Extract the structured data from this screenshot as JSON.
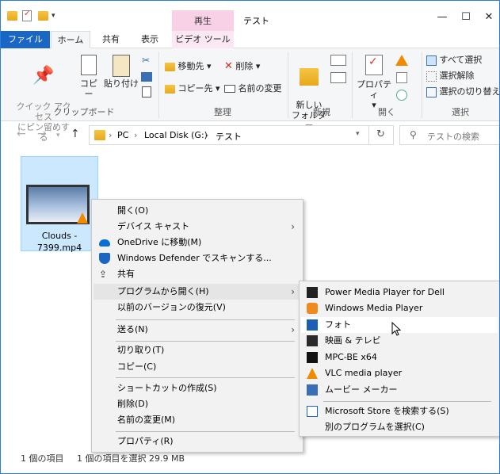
{
  "title_bar": {
    "context_tab": "再生",
    "window_title": "テスト",
    "minimize": "—",
    "maximize": "☐",
    "close": "✕"
  },
  "tabs": [
    {
      "label": "ファイル"
    },
    {
      "label": "ホーム"
    },
    {
      "label": "共有"
    },
    {
      "label": "表示"
    },
    {
      "label": "ビデオ ツール"
    }
  ],
  "ribbon": {
    "clipboard": {
      "pin": "クイック アクセス\nにピン留めする",
      "copy": "コピー",
      "paste": "貼り付け",
      "label": "クリップボード"
    },
    "organize": {
      "move_to": "移動先",
      "copy_to": "コピー先",
      "delete": "削除",
      "rename": "名前の変更",
      "label": "整理"
    },
    "new": {
      "new_folder": "新しい\nフォルダー",
      "label": "新規"
    },
    "open": {
      "properties": "プロパティ",
      "label": "開く"
    },
    "select": {
      "select_all": "すべて選択",
      "select_none": "選択解除",
      "invert": "選択の切り替え",
      "label": "選択"
    }
  },
  "address": {
    "segments": [
      "PC",
      "Local Disk (G:)",
      "テスト"
    ],
    "refresh": "↻",
    "search_placeholder": "テストの検索"
  },
  "file": {
    "name_line1": "Clouds -",
    "name_line2": "7399.mp4"
  },
  "status": {
    "count": "1 個の項目",
    "selected": "1 個の項目を選択  29.9 MB"
  },
  "context_menu": [
    {
      "label": "開く(O)"
    },
    {
      "label": "デバイス キャスト"
    },
    {
      "label": "OneDrive に移動(M)"
    },
    {
      "label": "Windows Defender でスキャンする..."
    },
    {
      "label": "共有"
    },
    {
      "label": "プログラムから開く(H)"
    },
    {
      "label": "以前のバージョンの復元(V)"
    },
    {
      "label": "送る(N)"
    },
    {
      "label": "切り取り(T)"
    },
    {
      "label": "コピー(C)"
    },
    {
      "label": "ショートカットの作成(S)"
    },
    {
      "label": "削除(D)"
    },
    {
      "label": "名前の変更(M)"
    },
    {
      "label": "プロパティ(R)"
    }
  ],
  "submenu": [
    {
      "label": "Power Media Player for Dell"
    },
    {
      "label": "Windows Media Player"
    },
    {
      "label": "フォト"
    },
    {
      "label": "映画 & テレビ"
    },
    {
      "label": "MPC-BE x64"
    },
    {
      "label": "VLC media player"
    },
    {
      "label": "ムービー メーカー"
    },
    {
      "label": "Microsoft Store を検索する(S)"
    },
    {
      "label": "別のプログラムを選択(C)"
    }
  ],
  "colors": {
    "accent": "#1a66c4",
    "selection": "#cce8ff",
    "context_tab": "#f8d1e6"
  }
}
